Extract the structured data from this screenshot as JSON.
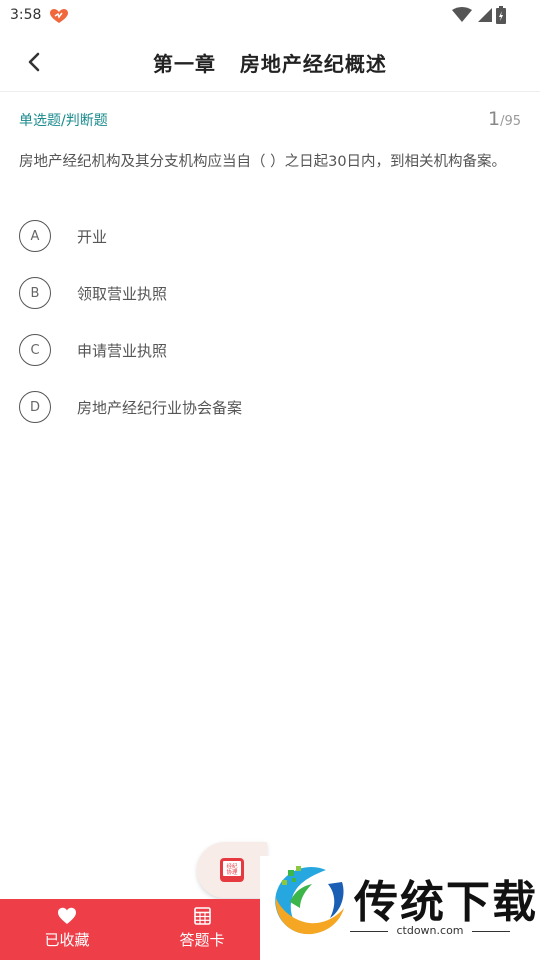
{
  "status_bar": {
    "time": "3:58"
  },
  "header": {
    "title": "第一章   房地产经纪概述"
  },
  "question": {
    "type": "单选题/判断题",
    "current": "1",
    "total": "/95",
    "stem": "房地产经纪机构及其分支机构应当自（      ）之日起30日内，到相关机构备案。",
    "options": [
      {
        "letter": "A",
        "text": "开业"
      },
      {
        "letter": "B",
        "text": "领取营业执照"
      },
      {
        "letter": "C",
        "text": "申请营业执照"
      },
      {
        "letter": "D",
        "text": "房地产经纪行业协会备案"
      }
    ]
  },
  "bottom_bar": {
    "favorite_label": "已收藏",
    "answer_card_label": "答题卡"
  },
  "float_badge": {
    "text": "经纪协理"
  },
  "watermark": {
    "name": "传统下载",
    "url": "ctdown.com"
  },
  "colors": {
    "accent": "#ee3e48",
    "type_label": "#1b8b8e"
  }
}
